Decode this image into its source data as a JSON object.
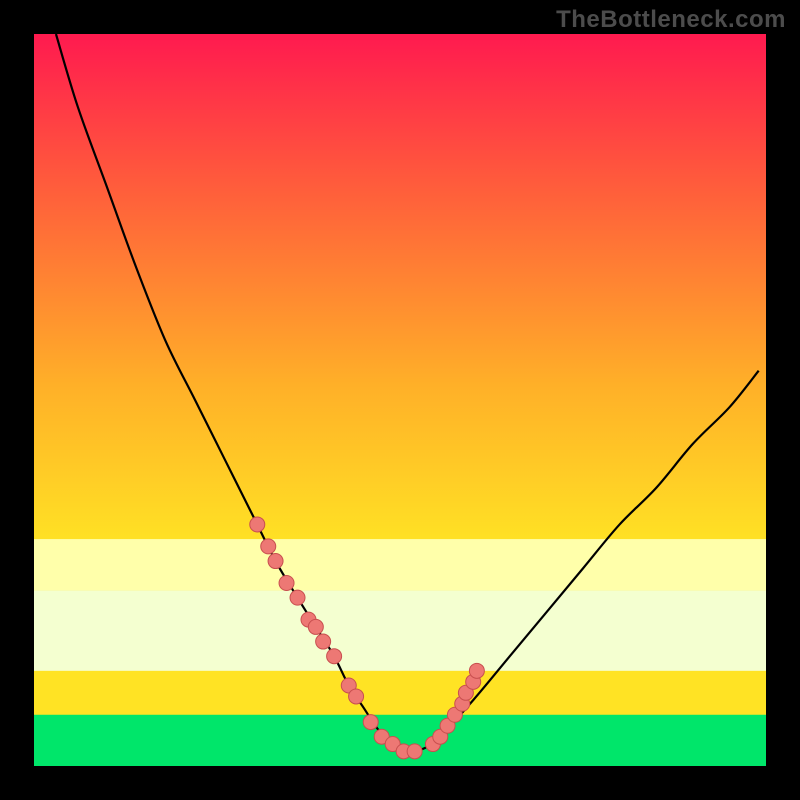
{
  "watermark": "TheBottleneck.com",
  "colors": {
    "bg": "#000000",
    "grad_top": "#ff1a4f",
    "grad_upper": "#ff5a3c",
    "grad_mid": "#ffb028",
    "grad_lowmid": "#ffe324",
    "grad_yellowband_top": "#fff070",
    "grad_yellowband_bot": "#ffffaa",
    "grad_paleband": "#f4ffd0",
    "grad_green": "#00e66a",
    "curve": "#000000",
    "dot_fill": "#ed7874",
    "dot_stroke": "#c84f4f"
  },
  "chart_data": {
    "type": "line",
    "title": "",
    "xlabel": "",
    "ylabel": "",
    "xlim": [
      0,
      100
    ],
    "ylim": [
      0,
      100
    ],
    "series": [
      {
        "name": "bottleneck-curve",
        "x": [
          3,
          6,
          10,
          14,
          18,
          22,
          26,
          30,
          33,
          36,
          38.5,
          41,
          43,
          45,
          47,
          49,
          50.5,
          52,
          53.5,
          55,
          60,
          65,
          70,
          75,
          80,
          85,
          90,
          95,
          99
        ],
        "values": [
          100,
          90,
          79,
          68,
          58,
          50,
          42,
          34,
          28,
          23,
          19,
          15,
          11,
          8,
          5,
          3,
          2,
          2,
          2.5,
          3.5,
          9,
          15,
          21,
          27,
          33,
          38,
          44,
          49,
          54
        ]
      }
    ],
    "highlight_points": {
      "name": "dots",
      "x": [
        30.5,
        32,
        33,
        34.5,
        36,
        37.5,
        38.5,
        39.5,
        41,
        43,
        44,
        46,
        47.5,
        49,
        50.5,
        52,
        54.5,
        55.5,
        56.5,
        57.5,
        58.5,
        59,
        60,
        60.5
      ],
      "values": [
        33,
        30,
        28,
        25,
        23,
        20,
        19,
        17,
        15,
        11,
        9.5,
        6,
        4,
        3,
        2,
        2,
        3,
        4,
        5.5,
        7,
        8.5,
        10,
        11.5,
        13
      ]
    },
    "bands": [
      {
        "name": "yellowband",
        "y_from": 24,
        "y_to": 31
      },
      {
        "name": "paleband",
        "y_from": 13,
        "y_to": 24
      },
      {
        "name": "greenband",
        "y_from": 0,
        "y_to": 7
      }
    ]
  }
}
